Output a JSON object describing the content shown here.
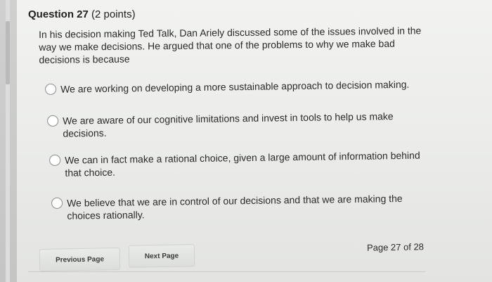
{
  "question": {
    "title": "Question 27",
    "points": "(2 points)",
    "text": "In his decision making Ted Talk, Dan Ariely discussed some of the issues involved in the way we make decisions. He argued that one of the problems to why we make bad decisions is because"
  },
  "options": [
    {
      "label": "We are working on developing a more sustainable approach to decision making."
    },
    {
      "label": "We are aware of our cognitive limitations and invest in tools to help us make decisions."
    },
    {
      "label": "We can in fact make a rational choice, given a large amount of information behind that choice."
    },
    {
      "label": "We believe that we are in control of our decisions and that we are making the choices rationally."
    }
  ],
  "navigation": {
    "previous_label": "Previous Page",
    "next_label": "Next Page",
    "page_indicator": "Page 27 of 28"
  }
}
